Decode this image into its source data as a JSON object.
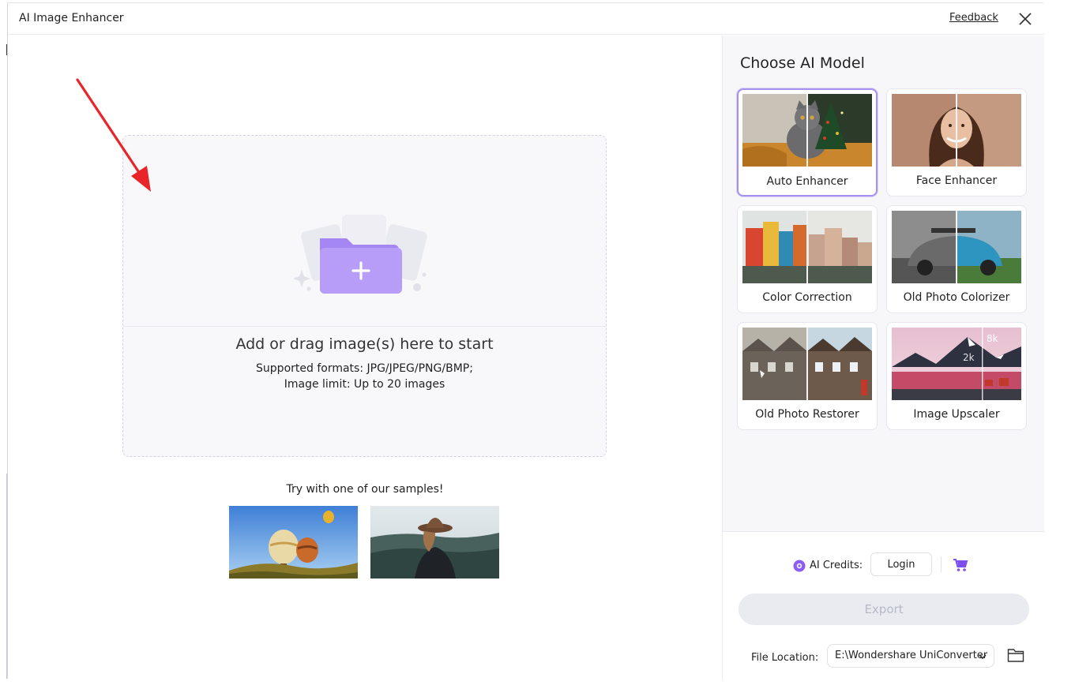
{
  "window": {
    "title": "AI Image Enhancer",
    "feedback_label": "Feedback"
  },
  "dropzone": {
    "title": "Add or drag image(s) here to start",
    "formats": "Supported formats: JPG/JPEG/PNG/BMP;",
    "limit": "Image limit: Up to 20 images"
  },
  "samples": {
    "label": "Try with one of our samples!"
  },
  "panel": {
    "title": "Choose AI Model",
    "models": [
      {
        "label": "Auto Enhancer",
        "selected": true
      },
      {
        "label": "Face Enhancer"
      },
      {
        "label": "Color Correction"
      },
      {
        "label": "Old Photo Colorizer"
      },
      {
        "label": "Old Photo Restorer"
      },
      {
        "label": "Image Upscaler",
        "badges": [
          "8k",
          "2k"
        ]
      }
    ],
    "credits_label": "AI Credits:",
    "login_label": "Login",
    "export_label": "Export",
    "file_location_label": "File Location:",
    "file_location_value": "E:\\Wondershare UniConverter"
  },
  "colors": {
    "accent": "#8b5cf6",
    "selected_border": "#a692ee",
    "annotation_arrow": "#e8262a"
  },
  "icons": [
    "close-icon",
    "folder-plus-icon",
    "ai-credits-icon",
    "cart-icon",
    "chevron-down-icon",
    "folder-icon"
  ]
}
